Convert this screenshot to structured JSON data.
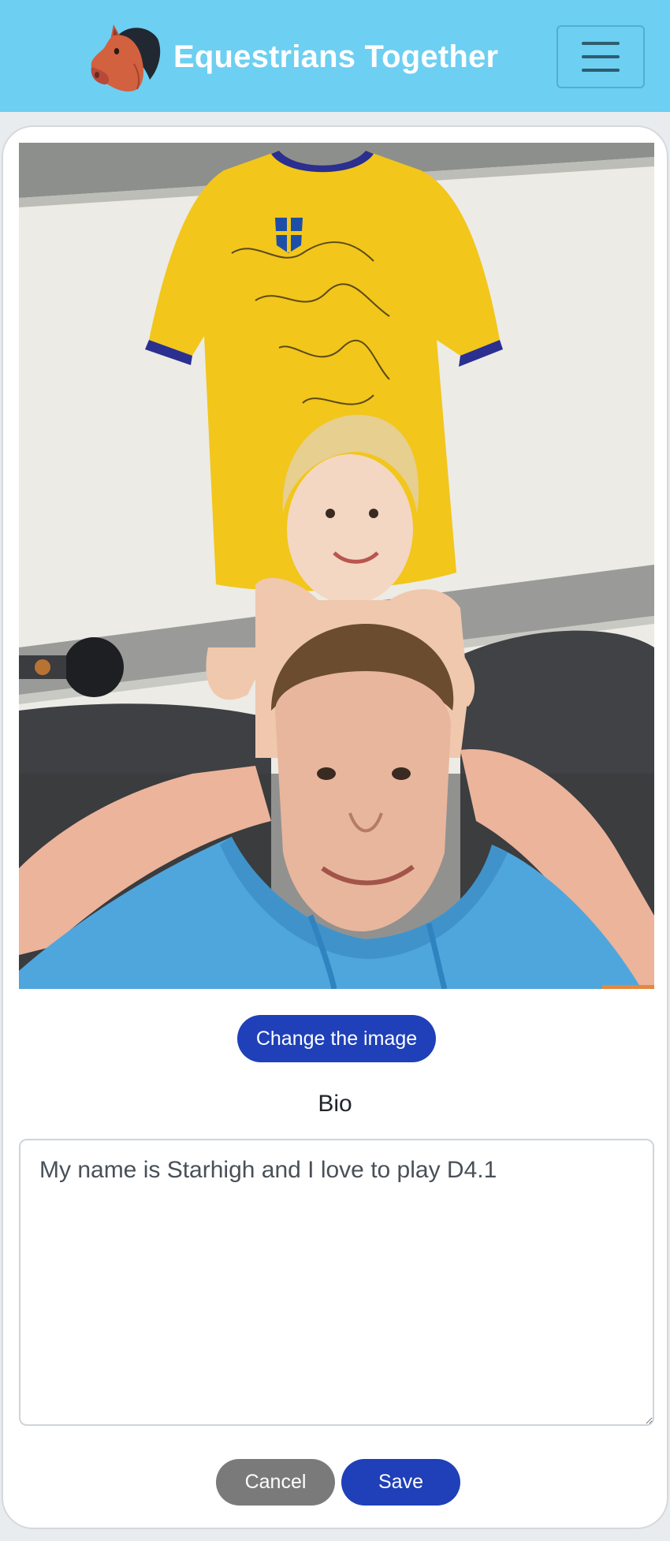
{
  "navbar": {
    "brand_text": "Equestrians Together",
    "logo_icon": "horse-head-icon",
    "menu_icon": "hamburger-menu-icon",
    "background_color": "#6dcff2"
  },
  "profile": {
    "photo_alt": "Profile picture",
    "change_image_label": "Change the image",
    "bio_label": "Bio",
    "bio_value": "My name is Starhigh and I love to play D4.1"
  },
  "actions": {
    "cancel_label": "Cancel",
    "save_label": "Save"
  },
  "colors": {
    "primary_button": "#1f40b8",
    "secondary_button": "#7a7a7a",
    "navbar": "#6dcff2"
  }
}
